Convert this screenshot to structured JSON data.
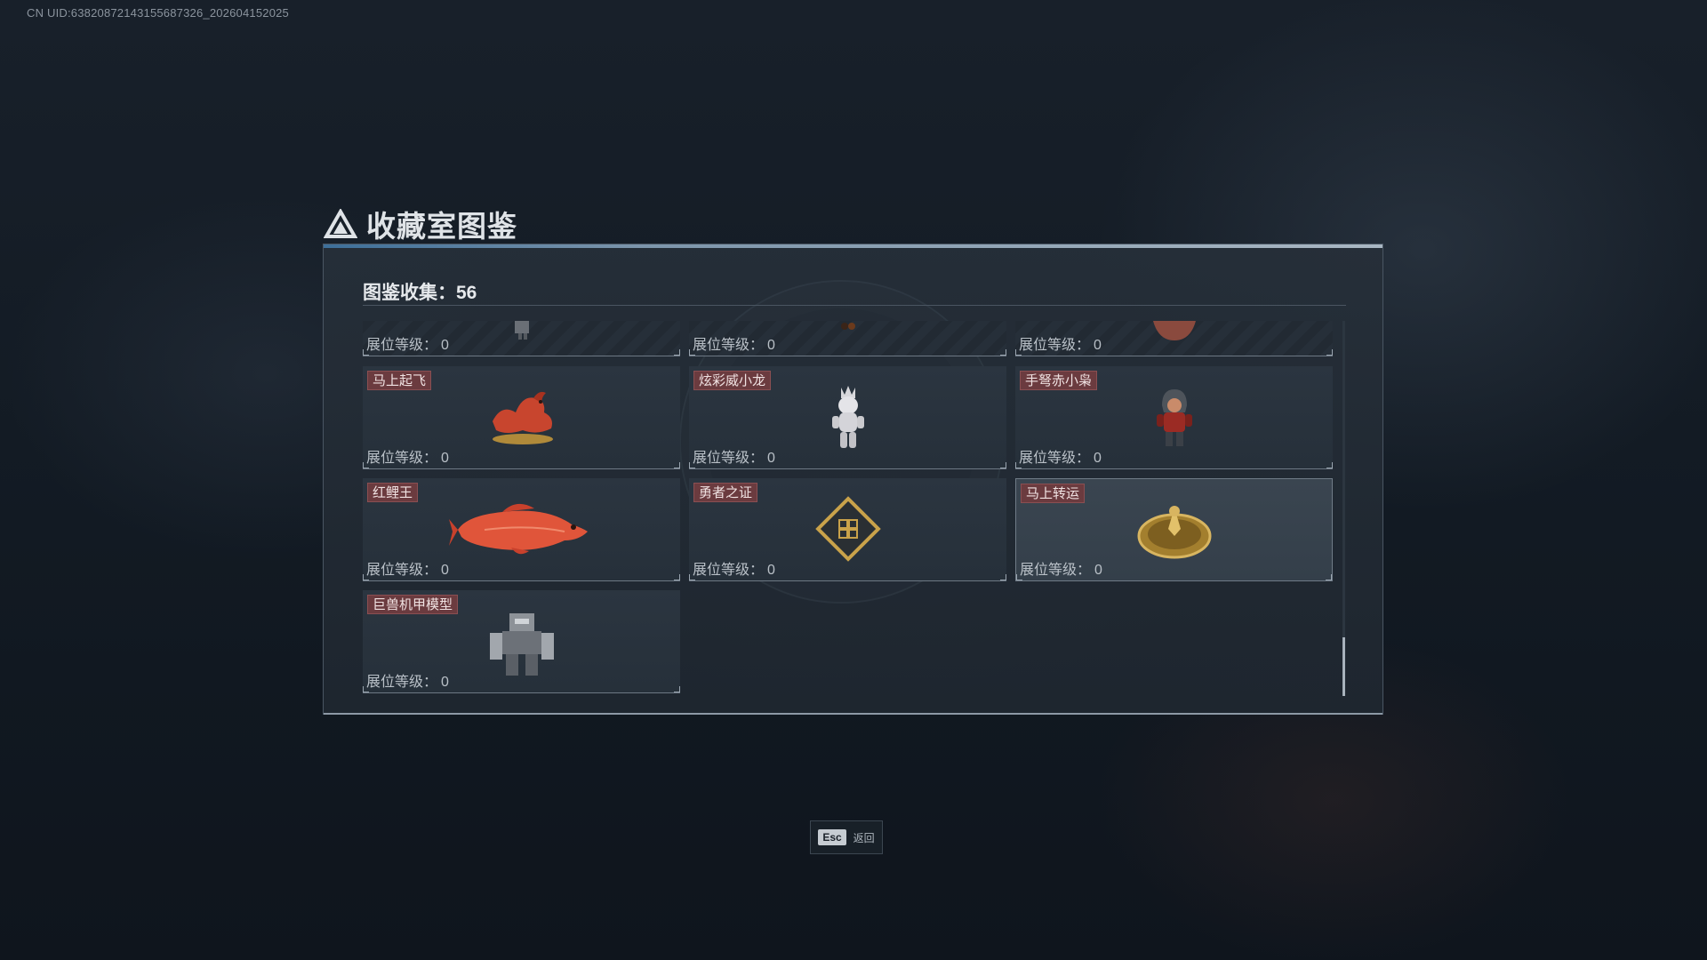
{
  "uid": "CN UID:638208721431556873​26_202604152025",
  "title": "收藏室图鉴",
  "collection": {
    "label": "图鉴收集：",
    "count": "56"
  },
  "level_label": "展位等级：",
  "cards": [
    {
      "name": "",
      "level": "0",
      "art": "partial-figure-icon"
    },
    {
      "name": "",
      "level": "0",
      "art": "partial-ornament-icon"
    },
    {
      "name": "",
      "level": "0",
      "art": "partial-vase-icon"
    },
    {
      "name": "马上起飞",
      "level": "0",
      "art": "red-horse-statue-icon"
    },
    {
      "name": "炫彩威小龙",
      "level": "0",
      "art": "white-dragon-figure-icon"
    },
    {
      "name": "手弩赤小枭",
      "level": "0",
      "art": "hooded-figure-icon"
    },
    {
      "name": "红鲤王",
      "level": "0",
      "art": "red-carp-icon"
    },
    {
      "name": "勇者之证",
      "level": "0",
      "art": "golden-badge-icon"
    },
    {
      "name": "马上转运",
      "level": "0",
      "art": "golden-compass-icon"
    },
    {
      "name": "巨兽机甲模型",
      "level": "0",
      "art": "mech-model-icon"
    }
  ],
  "footer": {
    "key": "Esc",
    "label": "返回"
  }
}
